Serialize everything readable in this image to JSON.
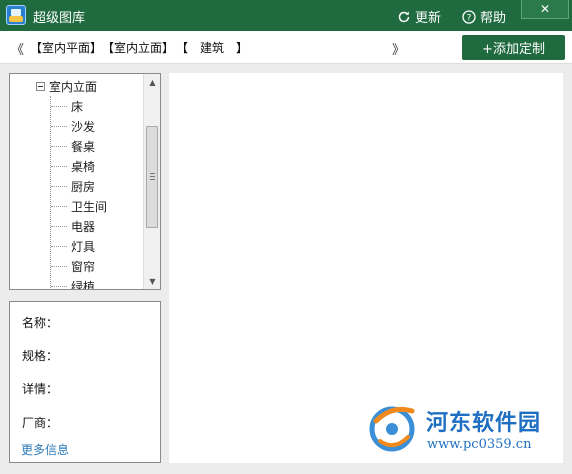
{
  "window": {
    "title": "超级图库",
    "refresh_label": "更新",
    "help_label": "帮助",
    "close_label": "✕"
  },
  "category_bar": {
    "nav_prev": "《",
    "nav_next": "》",
    "crumbs": [
      "【室内平面】",
      "【室内立面】",
      "【　建筑　】"
    ],
    "add_button": "+添加定制"
  },
  "tree": {
    "root_label": "室内立面",
    "items": [
      "床",
      "沙发",
      "餐桌",
      "桌椅",
      "厨房",
      "卫生间",
      "电器",
      "灯具",
      "窗帘",
      "绿植"
    ]
  },
  "info": {
    "name_label": "名称：",
    "spec_label": "规格：",
    "detail_label": "详情：",
    "vendor_label": "厂商：",
    "more_link": "更多信息"
  },
  "watermark": {
    "name": "河东软件园",
    "url": "www.pc0359.cn"
  }
}
